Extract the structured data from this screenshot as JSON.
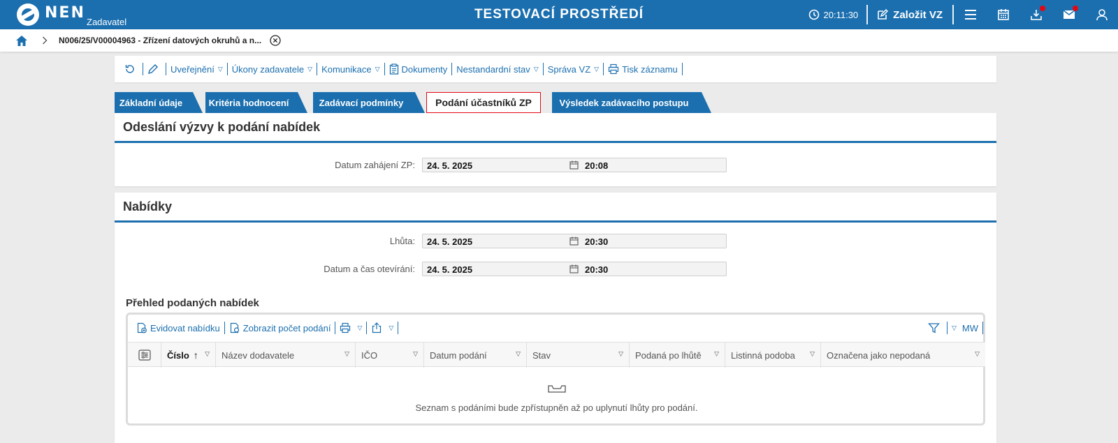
{
  "header": {
    "logo_text": "NEN",
    "logo_sub": "Zadavatel",
    "env_title": "TESTOVACÍ PROSTŘEDÍ",
    "clock": "20:11:30",
    "create_label": "Založit VZ"
  },
  "breadcrumb": {
    "title": "N006/25/V00004963 - Zřízení datových okruhů a n..."
  },
  "actions": {
    "publish": "Uveřejnění",
    "contracting_acts": "Úkony zadavatele",
    "communication": "Komunikace",
    "documents": "Dokumenty",
    "nonstandard_state": "Nestandardní stav",
    "management": "Správa VZ",
    "print_record": "Tisk záznamu"
  },
  "tabs": [
    {
      "label": "Základní údaje"
    },
    {
      "label": "Kritéria hodnocení"
    },
    {
      "label": "Zadávací podmínky"
    },
    {
      "label": "Podání účastníků ZP"
    },
    {
      "label": "Výsledek zadávacího postupu"
    }
  ],
  "invitation": {
    "title": "Odeslání výzvy k podání nabídek",
    "start_label": "Datum zahájení ZP:",
    "start_date": "24. 5. 2025",
    "start_time": "20:08"
  },
  "offers": {
    "title": "Nabídky",
    "deadline_label": "Lhůta:",
    "deadline_date": "24. 5. 2025",
    "deadline_time": "20:30",
    "opening_label": "Datum a čas otevírání:",
    "opening_date": "24. 5. 2025",
    "opening_time": "20:30",
    "overview_title": "Přehled podaných nabídek"
  },
  "grid": {
    "register_offer": "Evidovat nabídku",
    "show_count": "Zobrazit počet podání",
    "mw_label": "MW",
    "columns": [
      "Číslo",
      "Název dodavatele",
      "IČO",
      "Datum podání",
      "Stav",
      "Podaná po lhůtě",
      "Listinná podoba",
      "Označena jako nepodaná"
    ],
    "empty_text": "Seznam s podáními bude zpřístupněn až po uplynutí lhůty pro podání."
  }
}
